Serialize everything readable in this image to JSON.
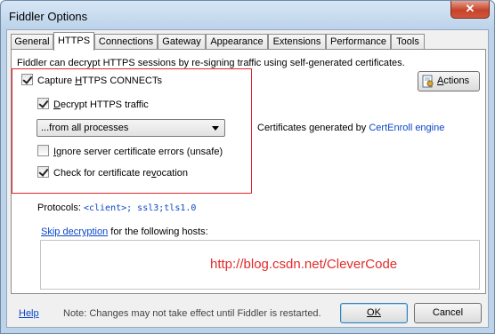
{
  "window": {
    "title": "Fiddler Options",
    "close_label": "✕"
  },
  "tabs": [
    {
      "label": "General"
    },
    {
      "label": "HTTPS",
      "active": true
    },
    {
      "label": "Connections"
    },
    {
      "label": "Gateway"
    },
    {
      "label": "Appearance"
    },
    {
      "label": "Extensions"
    },
    {
      "label": "Performance"
    },
    {
      "label": "Tools"
    }
  ],
  "https": {
    "description": "Fiddler can decrypt HTTPS sessions by re-signing traffic using self-generated certificates.",
    "actions_label": "Actions",
    "capture_connects": {
      "pre": "Capture ",
      "u": "H",
      "post": "TTPS CONNECTs",
      "checked": true
    },
    "decrypt_traffic": {
      "pre": "",
      "u": "D",
      "post": "ecrypt HTTPS traffic",
      "checked": true
    },
    "process_filter": "...from all processes",
    "ignore_errors": {
      "pre": "",
      "u": "I",
      "post": "gnore server certificate errors (unsafe)",
      "checked": false
    },
    "check_revocation": {
      "pre": "Check for certificate re",
      "u": "v",
      "post": "ocation",
      "checked": true
    },
    "cert_generated_text": "Certificates generated by ",
    "cert_engine_link": "CertEnroll engine",
    "protocols_label": "Protocols: ",
    "protocols_value": "<client>; ssl3;tls1.0",
    "skip_link": "Skip decryption",
    "skip_text": " for the following hosts:",
    "watermark": "http://blog.csdn.net/CleverCode"
  },
  "footer": {
    "help_label": "Help",
    "note": "Note: Changes may not take effect until Fiddler is restarted.",
    "ok_label": "OK",
    "cancel_label": "Cancel"
  },
  "colors": {
    "link": "#0b46c7",
    "highlight_box": "#e0242a",
    "watermark": "#e32b2b"
  }
}
